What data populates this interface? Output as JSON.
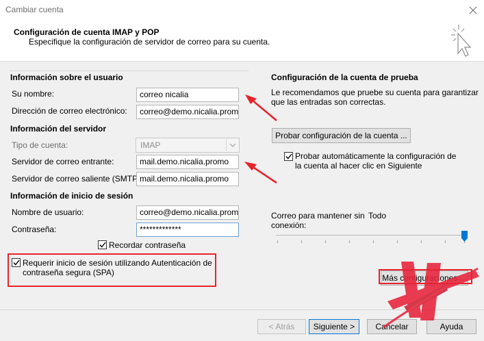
{
  "window": {
    "title": "Cambiar cuenta"
  },
  "header": {
    "title": "Configuración de cuenta IMAP y POP",
    "subtitle": "Especifique la configuración de servidor de correo para su cuenta."
  },
  "user_info": {
    "section_title": "Información sobre el usuario",
    "name_label": "Su nombre:",
    "name_value": "correo nicalia",
    "email_label": "Dirección de correo electrónico:",
    "email_value": "correo@demo.nicalia.promo"
  },
  "server_info": {
    "section_title": "Información del servidor",
    "account_type_label": "Tipo de cuenta:",
    "account_type_value": "IMAP",
    "incoming_label": "Servidor de correo entrante:",
    "incoming_value": "mail.demo.nicalia.promo",
    "outgoing_label": "Servidor de correo saliente (SMTP):",
    "outgoing_value": "mail.demo.nicalia.promo"
  },
  "login_info": {
    "section_title": "Información de inicio de sesión",
    "username_label": "Nombre de usuario:",
    "username_value": "correo@demo.nicalia.promo",
    "password_label": "Contraseña:",
    "password_value": "*************",
    "remember_label": "Recordar contraseña",
    "remember_checked": true,
    "spa_label_line1": "Requerir inicio de sesión utilizando Autenticación de",
    "spa_label_line2": "contraseña segura (SPA)",
    "spa_checked": true
  },
  "test_settings": {
    "section_title": "Configuración de la cuenta de prueba",
    "description_line1": "Le recomendamos que pruebe su cuenta para garantizar",
    "description_line2": "que las entradas son correctas.",
    "test_button": "Probar configuración de la cuenta ...",
    "auto_test_line1": "Probar automáticamente la configuración de",
    "auto_test_line2": "la cuenta al hacer clic en Siguiente",
    "auto_test_checked": true
  },
  "offline": {
    "label_line1": "Correo para mantener sin",
    "label_line2": "conexión:",
    "value": "Todo",
    "slider_level": 1.0
  },
  "more_settings": {
    "label": "Más configuraciones ..."
  },
  "footer": {
    "back": "< Atrás",
    "next": "Siguiente >",
    "cancel": "Cancelar",
    "help": "Ayuda"
  },
  "colors": {
    "annotation_red": "#e8232a",
    "accent_blue": "#0078d7",
    "logo_red": "#e8233a"
  },
  "icons": [
    "close-icon",
    "cursor-sparkle-icon",
    "chevron-down-icon",
    "checkmark-icon",
    "red-arrow-annotation",
    "watermark-logo"
  ]
}
